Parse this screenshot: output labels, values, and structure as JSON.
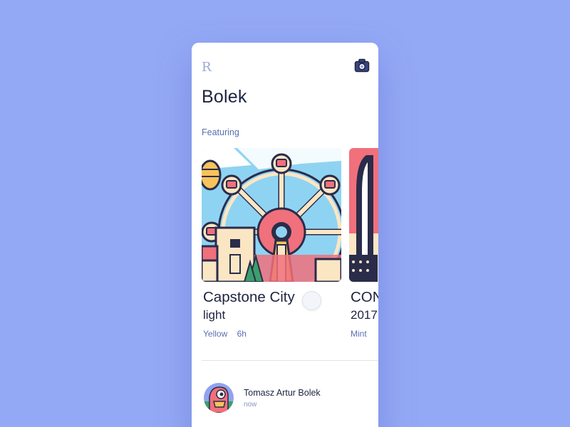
{
  "app": {
    "logo_text": "R",
    "title": "Bolek",
    "camera_icon": "camera-icon"
  },
  "featuring": {
    "label": "Featuring",
    "cards": [
      {
        "title": "Capstone City",
        "subtitle": "light",
        "tag": "Yellow",
        "duration": "6h",
        "image_icon": "ferris-wheel-illustration"
      },
      {
        "title": "CON",
        "subtitle": "2017",
        "tag": "Mint",
        "image_icon": "tower-illustration"
      }
    ]
  },
  "feed": {
    "items": [
      {
        "author": "Tomasz Artur Bolek",
        "time": "now",
        "avatar_icon": "bird-avatar"
      }
    ]
  },
  "colors": {
    "background": "#94a9f5",
    "card_bg": "#ffffff",
    "text_dark": "#1d2340",
    "accent_text": "#5c6fb0",
    "illustration_red": "#f0707c",
    "illustration_blue": "#8fd3f2",
    "illustration_cream": "#fbe6c4",
    "outline": "#2a2c4a"
  }
}
